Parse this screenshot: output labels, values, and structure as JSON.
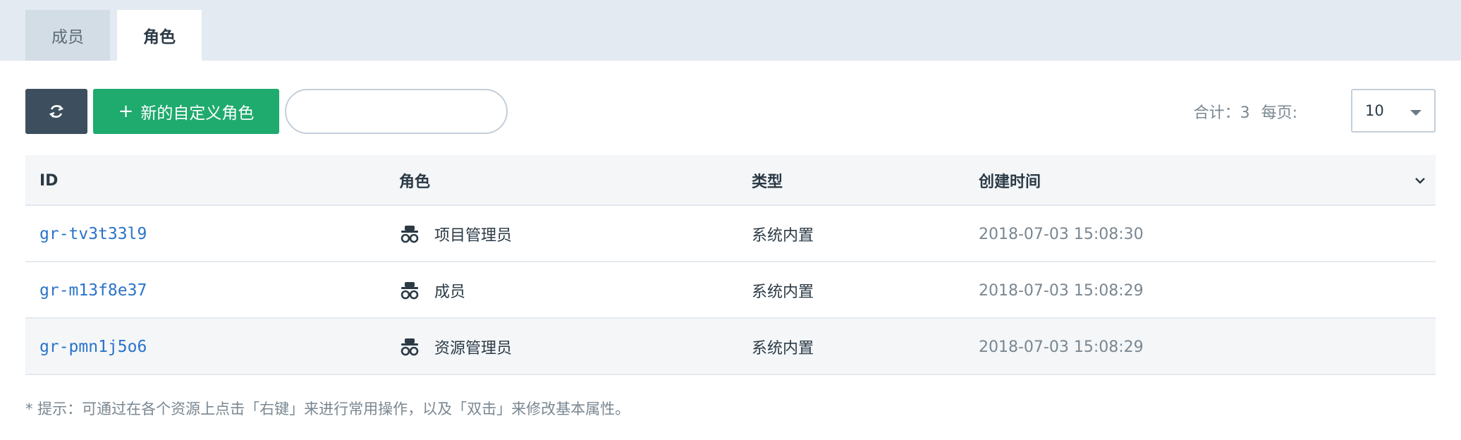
{
  "tabs": [
    {
      "label": "成员"
    },
    {
      "label": "角色"
    }
  ],
  "toolbar": {
    "new_role_label": "新的自定义角色",
    "search_placeholder": "",
    "total_label": "合计：3",
    "per_page_label": "每页:",
    "page_size": "10"
  },
  "table": {
    "headers": [
      "ID",
      "角色",
      "类型",
      "创建时间"
    ],
    "rows": [
      {
        "id": "gr-tv3t33l9",
        "role": "项目管理员",
        "type": "系统内置",
        "created": "2018-07-03 15:08:30"
      },
      {
        "id": "gr-m13f8e37",
        "role": "成员",
        "type": "系统内置",
        "created": "2018-07-03 15:08:29"
      },
      {
        "id": "gr-pmn1j5o6",
        "role": "资源管理员",
        "type": "系统内置",
        "created": "2018-07-03 15:08:29"
      }
    ]
  },
  "hint": "* 提示：可通过在各个资源上点击「右键」来进行常用操作，以及「双击」来修改基本属性。",
  "icons": {
    "refresh": "refresh-icon",
    "plus": "plus-icon",
    "role": "spy-icon",
    "dropdown": "chevron-down-icon"
  },
  "colors": {
    "primary_button": "#1faa6e",
    "dark_button": "#3d4f5e",
    "link": "#2a73c8",
    "tabbar": "#e3eaf1"
  }
}
